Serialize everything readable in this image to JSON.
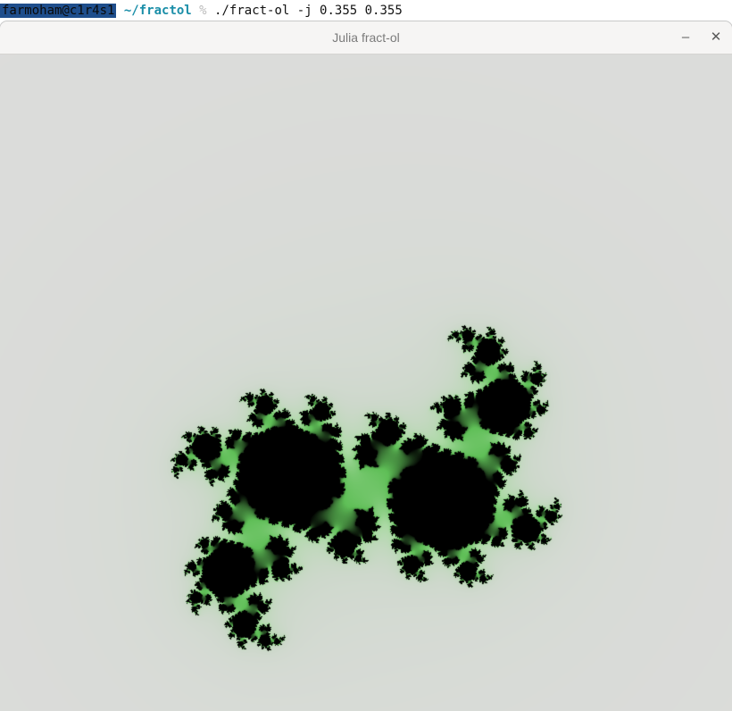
{
  "terminal": {
    "user_host": "farmoham@c1r4s1",
    "cwd": "~/fractol",
    "prompt_symbol": "%",
    "command": "./fract-ol -j 0.355 0.355"
  },
  "window": {
    "title": "Julia fract-ol",
    "minimize_symbol": "–",
    "close_symbol": "✕"
  },
  "fractal": {
    "type": "julia",
    "c_real": 0.355,
    "c_imag": 0.355,
    "colors": {
      "background": "#dcdcdb",
      "glow": "#cdd8cb",
      "body": "#a9d9a2",
      "bright": "#5fbf57",
      "core": "#000000"
    }
  }
}
